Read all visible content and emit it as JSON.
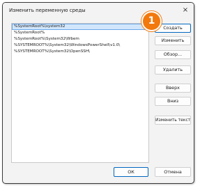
{
  "window": {
    "title": "Изменить переменную среды",
    "close_icon": "×"
  },
  "list": {
    "items": [
      {
        "label": "%SystemRoot%\\system32",
        "selected": true
      },
      {
        "label": "%SystemRoot%",
        "selected": false
      },
      {
        "label": "%SystemRoot%\\System32\\Wbem",
        "selected": false
      },
      {
        "label": "%SYSTEMROOT%\\System32\\WindowsPowerShell\\v1.0\\",
        "selected": false
      },
      {
        "label": "%SYSTEMROOT%\\System32\\OpenSSH\\",
        "selected": false
      }
    ]
  },
  "buttons": {
    "create": "Создать",
    "edit": "Изменить",
    "browse": "Обзор...",
    "delete": "Удалить",
    "up": "Вверх",
    "down": "Вниз",
    "edit_text": "Изменить текст...",
    "ok": "ОК",
    "cancel": "Отмена"
  },
  "annotation": {
    "number": "1",
    "color": "#f2790e"
  }
}
